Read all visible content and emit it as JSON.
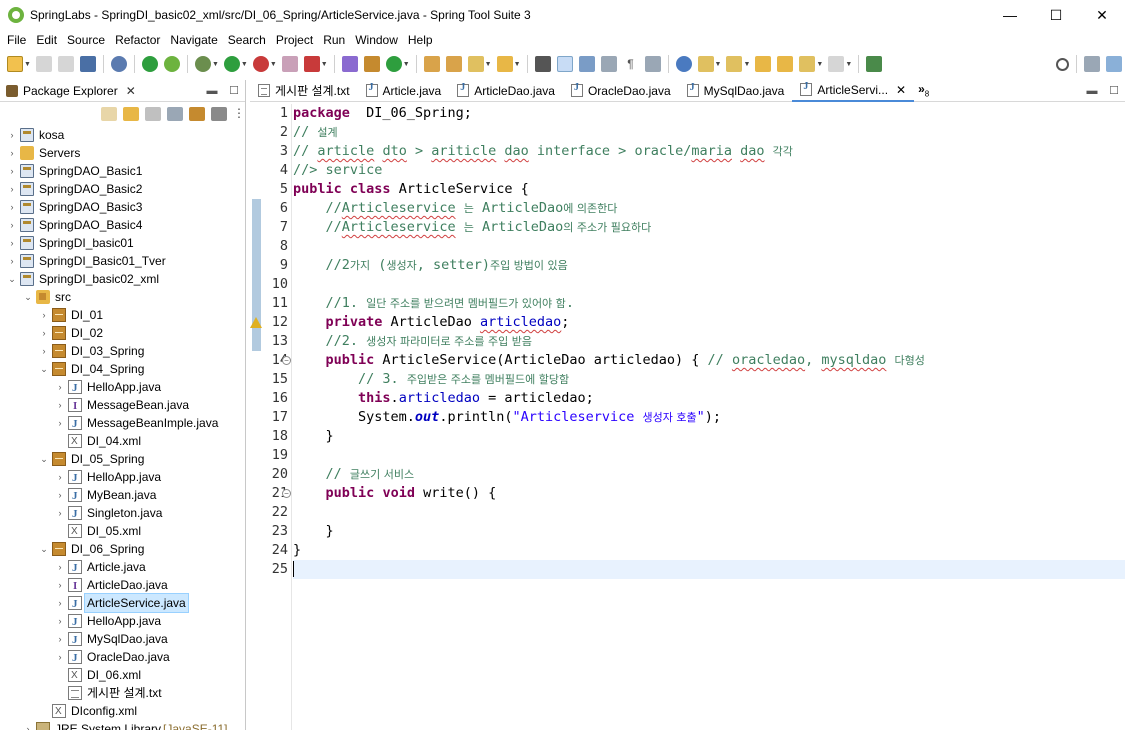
{
  "window": {
    "title": "SpringLabs - SpringDI_basic02_xml/src/DI_06_Spring/ArticleService.java - Spring Tool Suite 3",
    "controls": {
      "minimize": "—",
      "maximize": "☐",
      "close": "✕"
    }
  },
  "menu": [
    "File",
    "Edit",
    "Source",
    "Refactor",
    "Navigate",
    "Search",
    "Project",
    "Run",
    "Window",
    "Help"
  ],
  "explorer": {
    "title": "Package Explorer",
    "close": "✕",
    "tree": [
      {
        "label": "kosa",
        "icon": "project-icon",
        "depth": 0,
        "twisty": "›"
      },
      {
        "label": "Servers",
        "icon": "folder-icon",
        "depth": 0,
        "twisty": "›"
      },
      {
        "label": "SpringDAO_Basic1",
        "icon": "project-icon",
        "depth": 0,
        "twisty": "›"
      },
      {
        "label": "SpringDAO_Basic2",
        "icon": "project-icon",
        "depth": 0,
        "twisty": "›"
      },
      {
        "label": "SpringDAO_Basic3",
        "icon": "project-icon",
        "depth": 0,
        "twisty": "›"
      },
      {
        "label": "SpringDAO_Basic4",
        "icon": "project-icon",
        "depth": 0,
        "twisty": "›"
      },
      {
        "label": "SpringDI_basic01",
        "icon": "project-icon",
        "depth": 0,
        "twisty": "›"
      },
      {
        "label": "SpringDI_Basic01_Tver",
        "icon": "project-icon",
        "depth": 0,
        "twisty": "›"
      },
      {
        "label": "SpringDI_basic02_xml",
        "icon": "project-icon",
        "depth": 0,
        "twisty": "⌄"
      },
      {
        "label": "src",
        "icon": "src-folder-icon",
        "depth": 1,
        "twisty": "⌄"
      },
      {
        "label": "DI_01",
        "icon": "package-icon",
        "depth": 2,
        "twisty": "›"
      },
      {
        "label": "DI_02",
        "icon": "package-icon",
        "depth": 2,
        "twisty": "›"
      },
      {
        "label": "DI_03_Spring",
        "icon": "package-icon",
        "depth": 2,
        "twisty": "›"
      },
      {
        "label": "DI_04_Spring",
        "icon": "package-icon",
        "depth": 2,
        "twisty": "⌄"
      },
      {
        "label": "HelloApp.java",
        "icon": "java-file-icon",
        "depth": 3,
        "twisty": "›"
      },
      {
        "label": "MessageBean.java",
        "icon": "java-interface-icon",
        "depth": 3,
        "twisty": "›"
      },
      {
        "label": "MessageBeanImple.java",
        "icon": "java-file-icon",
        "depth": 3,
        "twisty": "›"
      },
      {
        "label": "DI_04.xml",
        "icon": "xml-file-icon",
        "depth": 3,
        "twisty": ""
      },
      {
        "label": "DI_05_Spring",
        "icon": "package-icon",
        "depth": 2,
        "twisty": "⌄"
      },
      {
        "label": "HelloApp.java",
        "icon": "java-file-icon",
        "depth": 3,
        "twisty": "›"
      },
      {
        "label": "MyBean.java",
        "icon": "java-file-icon",
        "depth": 3,
        "twisty": "›"
      },
      {
        "label": "Singleton.java",
        "icon": "java-file-icon",
        "depth": 3,
        "twisty": "›"
      },
      {
        "label": "DI_05.xml",
        "icon": "xml-file-icon",
        "depth": 3,
        "twisty": ""
      },
      {
        "label": "DI_06_Spring",
        "icon": "package-icon",
        "depth": 2,
        "twisty": "⌄"
      },
      {
        "label": "Article.java",
        "icon": "java-file-icon",
        "depth": 3,
        "twisty": "›"
      },
      {
        "label": "ArticleDao.java",
        "icon": "java-interface-icon",
        "depth": 3,
        "twisty": "›"
      },
      {
        "label": "ArticleService.java",
        "icon": "java-file-icon",
        "depth": 3,
        "twisty": "›",
        "selected": true
      },
      {
        "label": "HelloApp.java",
        "icon": "java-file-icon",
        "depth": 3,
        "twisty": "›"
      },
      {
        "label": "MySqlDao.java",
        "icon": "java-file-icon",
        "depth": 3,
        "twisty": "›"
      },
      {
        "label": "OracleDao.java",
        "icon": "java-file-icon",
        "depth": 3,
        "twisty": "›"
      },
      {
        "label": "DI_06.xml",
        "icon": "xml-file-icon",
        "depth": 3,
        "twisty": ""
      },
      {
        "label": "게시판 설계.txt",
        "icon": "text-file-icon",
        "depth": 3,
        "twisty": ""
      },
      {
        "label": "DIconfig.xml",
        "icon": "xml-file-icon",
        "depth": 2,
        "twisty": ""
      },
      {
        "label": "JRE System Library",
        "suffix": " [JavaSE-11]",
        "icon": "library-icon",
        "depth": 1,
        "twisty": "›"
      }
    ]
  },
  "editor": {
    "tabs": [
      {
        "label": "게시판 설계.txt",
        "type": "txt"
      },
      {
        "label": "Article.java",
        "type": "java"
      },
      {
        "label": "ArticleDao.java",
        "type": "java"
      },
      {
        "label": "OracleDao.java",
        "type": "java"
      },
      {
        "label": "MySqlDao.java",
        "type": "java"
      },
      {
        "label": "ArticleServi...",
        "type": "java",
        "active": true
      }
    ],
    "overflow": "»",
    "overflow_count": "8",
    "lines": [
      [
        [
          "kw",
          "package"
        ],
        [
          "",
          "  DI_06_Spring;"
        ]
      ],
      [
        [
          "cm",
          "// "
        ],
        [
          "cm-ko",
          "설계"
        ]
      ],
      [
        [
          "cm",
          "// "
        ],
        [
          "cm sq",
          "article"
        ],
        [
          "cm",
          " "
        ],
        [
          "cm sq",
          "dto"
        ],
        [
          "cm",
          " > "
        ],
        [
          "cm sq",
          "ariticle"
        ],
        [
          "cm",
          " "
        ],
        [
          "cm sq",
          "dao"
        ],
        [
          "cm",
          " interface > oracle/"
        ],
        [
          "cm sq",
          "maria"
        ],
        [
          "cm",
          " "
        ],
        [
          "cm sq",
          "dao"
        ],
        [
          "cm",
          " "
        ],
        [
          "cm-ko",
          "각각"
        ]
      ],
      [
        [
          "cm",
          "//> service"
        ]
      ],
      [
        [
          "kw",
          "public"
        ],
        [
          "",
          " "
        ],
        [
          "kw",
          "class"
        ],
        [
          "",
          " ArticleService {"
        ]
      ],
      [
        [
          "",
          "    "
        ],
        [
          "cm",
          "//"
        ],
        [
          "cm sq",
          "Articleservice"
        ],
        [
          "cm",
          " "
        ],
        [
          "cm-ko",
          "는"
        ],
        [
          "cm",
          " ArticleDao"
        ],
        [
          "cm-ko",
          "에 의존한다"
        ]
      ],
      [
        [
          "",
          "    "
        ],
        [
          "cm",
          "//"
        ],
        [
          "cm sq",
          "Articleservice"
        ],
        [
          "cm",
          " "
        ],
        [
          "cm-ko",
          "는"
        ],
        [
          "cm",
          " ArticleDao"
        ],
        [
          "cm-ko",
          "의 주소가 필요하다"
        ]
      ],
      [
        [
          "",
          ""
        ]
      ],
      [
        [
          "",
          "    "
        ],
        [
          "cm",
          "//2"
        ],
        [
          "cm-ko",
          "가지"
        ],
        [
          "cm",
          " ("
        ],
        [
          "cm-ko",
          "생성자"
        ],
        [
          "cm",
          ", setter)"
        ],
        [
          "cm-ko",
          "주입 방법이 있음"
        ]
      ],
      [
        [
          "",
          ""
        ]
      ],
      [
        [
          "",
          "    "
        ],
        [
          "cm",
          "//1. "
        ],
        [
          "cm-ko",
          "일단 주소를 받으려면 멤버필드가 있어야 함"
        ],
        [
          "cm",
          "."
        ]
      ],
      [
        [
          "",
          "    "
        ],
        [
          "kw",
          "private"
        ],
        [
          "",
          " ArticleDao "
        ],
        [
          "fld sq",
          "articledao"
        ],
        [
          "",
          ";"
        ]
      ],
      [
        [
          "",
          "    "
        ],
        [
          "cm",
          "//2. "
        ],
        [
          "cm-ko",
          "생성자 파라미터로 주소를 주입 받음"
        ]
      ],
      [
        [
          "",
          "    "
        ],
        [
          "kw",
          "public"
        ],
        [
          "",
          " ArticleService(ArticleDao articledao) { "
        ],
        [
          "cm",
          "// "
        ],
        [
          "cm sq",
          "oracledao"
        ],
        [
          "cm",
          ", "
        ],
        [
          "cm sq",
          "mysqldao"
        ],
        [
          "cm",
          " "
        ],
        [
          "cm-ko",
          "다형성"
        ]
      ],
      [
        [
          "",
          "        "
        ],
        [
          "cm",
          "// 3. "
        ],
        [
          "cm-ko",
          "주입받은 주소를 멤버필드에 할당함"
        ]
      ],
      [
        [
          "",
          "        "
        ],
        [
          "kw",
          "this"
        ],
        [
          "",
          "."
        ],
        [
          "fld",
          "articledao"
        ],
        [
          "",
          " = articledao;"
        ]
      ],
      [
        [
          "",
          "        System."
        ],
        [
          "ital",
          "out"
        ],
        [
          "",
          ".println("
        ],
        [
          "str",
          "\"Articleservice "
        ],
        [
          "str cm-ko-str",
          "생성자 호출"
        ],
        [
          "str",
          "\""
        ],
        [
          "",
          ");"
        ]
      ],
      [
        [
          "",
          "    }"
        ]
      ],
      [
        [
          "",
          ""
        ]
      ],
      [
        [
          "",
          "    "
        ],
        [
          "cm",
          "// "
        ],
        [
          "cm-ko",
          "글쓰기 서비스"
        ]
      ],
      [
        [
          "",
          "    "
        ],
        [
          "kw",
          "public"
        ],
        [
          "",
          " "
        ],
        [
          "kw",
          "void"
        ],
        [
          "",
          " write() {"
        ]
      ],
      [
        [
          "",
          ""
        ]
      ],
      [
        [
          "",
          "    }"
        ]
      ],
      [
        [
          "",
          "}"
        ]
      ],
      [
        [
          "",
          ""
        ]
      ]
    ],
    "line_numbers": [
      "1",
      "2",
      "3",
      "4",
      "5",
      "6",
      "7",
      "8",
      "9",
      "10",
      "11",
      "12",
      "13",
      "14",
      "15",
      "16",
      "17",
      "18",
      "19",
      "20",
      "21",
      "22",
      "23",
      "24",
      "25"
    ],
    "fold_markers": [
      "14",
      "21"
    ],
    "warning_line": "12",
    "current_line": "25",
    "changed_lines": [
      "6",
      "7",
      "8",
      "9",
      "10",
      "11",
      "12",
      "13"
    ]
  },
  "colors": {
    "keyword": "#7f0055",
    "comment": "#3f7f5f",
    "field": "#0000c0",
    "string": "#2a00ff",
    "selection": "#cce8ff",
    "current_line": "#e8f2fe"
  }
}
